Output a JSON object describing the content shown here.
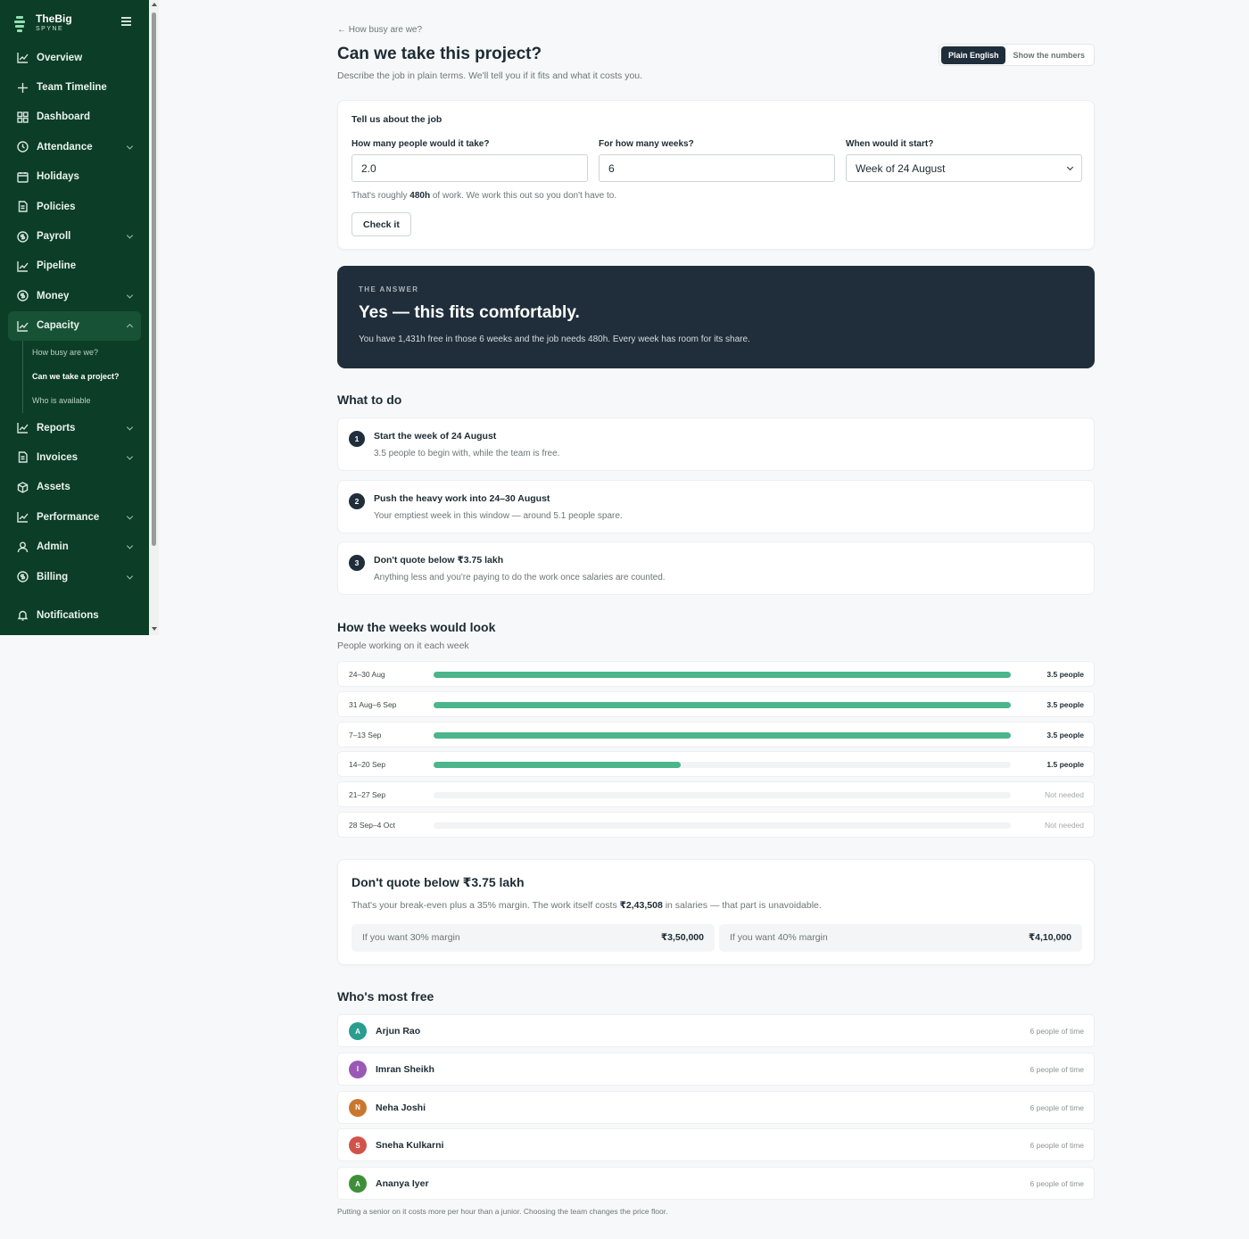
{
  "brand": {
    "name": "TheBig",
    "sub": "SPYNE"
  },
  "nav": [
    {
      "label": "Overview",
      "icon": "chart-line-icon",
      "chevron": false
    },
    {
      "label": "Team Timeline",
      "icon": "timeline-icon",
      "chevron": false
    },
    {
      "label": "Dashboard",
      "icon": "grid-icon",
      "chevron": false
    },
    {
      "label": "Attendance",
      "icon": "clock-icon",
      "chevron": true
    },
    {
      "label": "Holidays",
      "icon": "calendar-icon",
      "chevron": false
    },
    {
      "label": "Policies",
      "icon": "document-icon",
      "chevron": false
    },
    {
      "label": "Payroll",
      "icon": "coin-icon",
      "chevron": true
    },
    {
      "label": "Pipeline",
      "icon": "chart-line-icon",
      "chevron": false
    },
    {
      "label": "Money",
      "icon": "coin-icon",
      "chevron": true
    },
    {
      "label": "Capacity",
      "icon": "chart-line-icon",
      "chevron": true,
      "active": true
    }
  ],
  "capacity_sub": [
    {
      "label": "How busy are we?"
    },
    {
      "label": "Can we take a project?",
      "current": true
    },
    {
      "label": "Who is available"
    }
  ],
  "nav2": [
    {
      "label": "Reports",
      "icon": "chart-line-icon",
      "chevron": true
    },
    {
      "label": "Invoices",
      "icon": "document-icon",
      "chevron": true
    },
    {
      "label": "Assets",
      "icon": "box-icon",
      "chevron": false
    },
    {
      "label": "Performance",
      "icon": "chart-line-icon",
      "chevron": true
    },
    {
      "label": "Admin",
      "icon": "user-icon",
      "chevron": true
    },
    {
      "label": "Billing",
      "icon": "coin-icon",
      "chevron": true
    }
  ],
  "nav3": [
    {
      "label": "Notifications",
      "icon": "bell-icon"
    }
  ],
  "header": {
    "crumb": "← How busy are we?",
    "title": "Can we take this project?",
    "subtitle": "Describe the job in plain terms. We'll tell you if it fits and what it costs you.",
    "toggle_on": "Plain English",
    "toggle_off": "Show the numbers"
  },
  "form": {
    "title": "Tell us about the job",
    "people_label": "How many people would it take?",
    "people_value": "2.0",
    "weeks_label": "For how many weeks?",
    "weeks_value": "6",
    "start_label": "When would it start?",
    "start_value": "Week of 24 August",
    "hint_pre": "That's roughly ",
    "hint_hours": "480h",
    "hint_post": " of work. We work this out so you don't have to.",
    "button": "Check it"
  },
  "answer": {
    "eyebrow": "THE ANSWER",
    "headline": "Yes — this fits comfortably.",
    "detail": "You have 1,431h free in those 6 weeks and the job needs 480h. Every week has room for its share."
  },
  "todo": {
    "title": "What to do",
    "steps": [
      {
        "num": "1",
        "title": "Start the week of 24 August",
        "sub": "3.5 people to begin with, while the team is free."
      },
      {
        "num": "2",
        "title": "Push the heavy work into 24–30 August",
        "sub": "Your emptiest week in this window — around 5.1 people spare."
      },
      {
        "num": "3",
        "title": "Don't quote below ₹3.75 lakh",
        "sub": "Anything less and you're paying to do the work once salaries are counted."
      }
    ]
  },
  "weeks": {
    "title": "How the weeks would look",
    "sub": "People working on it each week",
    "max_people": 3.5,
    "rows": [
      {
        "label": "24–30 Aug",
        "people": 3.5,
        "value": "3.5 people"
      },
      {
        "label": "31 Aug–6 Sep",
        "people": 3.5,
        "value": "3.5 people"
      },
      {
        "label": "7–13 Sep",
        "people": 3.5,
        "value": "3.5 people"
      },
      {
        "label": "14–20 Sep",
        "people": 1.5,
        "value": "1.5 people"
      },
      {
        "label": "21–27 Sep",
        "people": 0,
        "value": "Not needed"
      },
      {
        "label": "28 Sep–4 Oct",
        "people": 0,
        "value": "Not needed"
      }
    ],
    "bar_color": "#4bb58c"
  },
  "quote": {
    "title": "Don't quote below ₹3.75 lakh",
    "sub_pre": "That's your break-even plus a 35% margin. The work itself costs ",
    "sub_amount": "₹2,43,508",
    "sub_post": " in salaries — that part is unavoidable.",
    "m30_label": "If you want 30% margin",
    "m30_value": "₹3,50,000",
    "m40_label": "If you want 40% margin",
    "m40_value": "₹4,10,000"
  },
  "free": {
    "title": "Who's most free",
    "people": [
      {
        "initial": "A",
        "name": "Arjun Rao",
        "time": "6 people of time",
        "color": "#2a9d8f"
      },
      {
        "initial": "I",
        "name": "Imran Sheikh",
        "time": "6 people of time",
        "color": "#9b59b6"
      },
      {
        "initial": "N",
        "name": "Neha Joshi",
        "time": "6 people of time",
        "color": "#c9772f"
      },
      {
        "initial": "S",
        "name": "Sneha Kulkarni",
        "time": "6 people of time",
        "color": "#d0534a"
      },
      {
        "initial": "A",
        "name": "Ananya Iyer",
        "time": "6 people of time",
        "color": "#3f8f3a"
      }
    ],
    "footnote": "Putting a senior on it costs more per hour than a junior. Choosing the team changes the price floor."
  }
}
